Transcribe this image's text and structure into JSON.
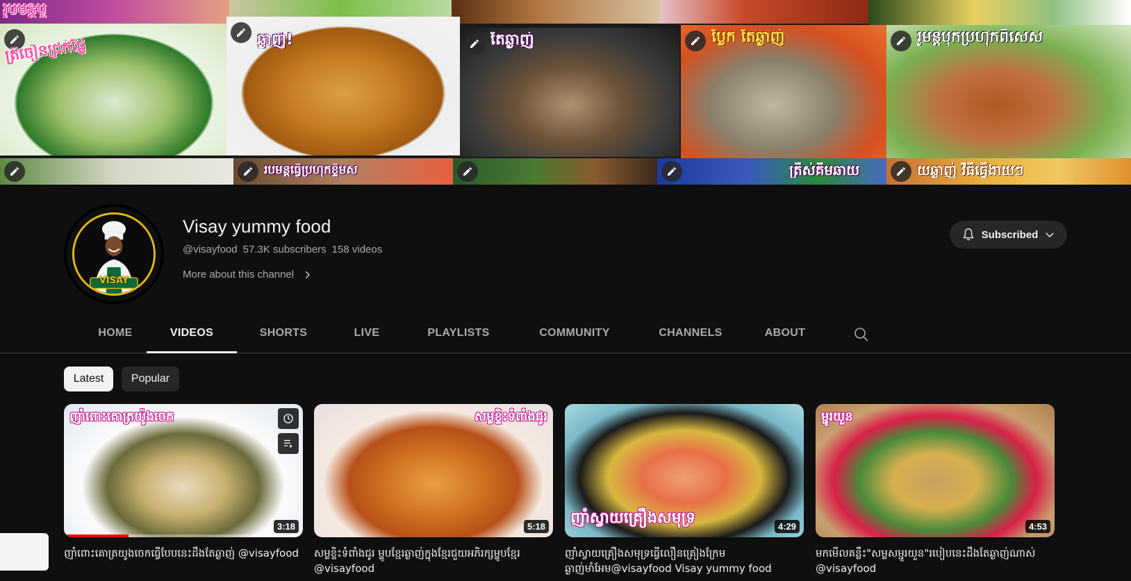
{
  "banner": {
    "tiles": [
      {
        "caption": "រូបមន្តបួ",
        "style": "pink"
      },
      {
        "caption": "",
        "style": ""
      },
      {
        "caption": "",
        "style": ""
      },
      {
        "caption": "",
        "style": ""
      },
      {
        "caption": "",
        "style": ""
      },
      {
        "caption": "ត្រីចៀនជ្រក់ផ្លែ",
        "style": "pink"
      },
      {
        "caption": "ឆ្ងាញ់!",
        "style": ""
      },
      {
        "caption": "តែឆ្ងាញ់",
        "style": ""
      },
      {
        "caption": "ប្លែក តែឆ្ងាញ់",
        "style": ""
      },
      {
        "caption": "រូមន្តបុកប្រហុកពិសេស",
        "style": ""
      },
      {
        "caption": "",
        "style": ""
      },
      {
        "caption": "របមន្តធ្វើប្រហុកខ្ទឹមស",
        "style": "small"
      },
      {
        "caption": "",
        "style": ""
      },
      {
        "caption": "ត្រីស់គីមឆាយ",
        "style": ""
      },
      {
        "caption": "យឆ្ងាញ់ វិធីធ្វើងាយៗ",
        "style": ""
      }
    ]
  },
  "channel": {
    "name": "Visay yummy food",
    "handle": "@visayfood",
    "subscribers": "57.3K subscribers",
    "videos": "158 videos",
    "more_about": "More about this channel",
    "avatar_badge": "VISAY",
    "subscribe_label": "Subscribed"
  },
  "tabs": [
    "HOME",
    "VIDEOS",
    "SHORTS",
    "LIVE",
    "PLAYLISTS",
    "COMMUNITY",
    "CHANNELS",
    "ABOUT"
  ],
  "active_tab": "VIDEOS",
  "chips": [
    "Latest",
    "Popular"
  ],
  "active_chip": "Latest",
  "videos": [
    {
      "thumb_caption": "ញាំពោះគោត្រយ៉ូងចេក",
      "duration": "3:18",
      "watched_fraction": 0.27,
      "title": "ញាំពោះគោត្រយូងចេកធ្វើបែបនេះដឹងតែឆ្ងាញ់ @visayfood"
    },
    {
      "thumb_caption": "សម្លខ្ទិះទំពាំងជូរ",
      "duration": "5:18",
      "watched_fraction": 0,
      "title": "សម្លខ្ទិះទំពាំងជូរ ម្ហូបខ្មែរឆ្ងាញ់ក្នុងខ្មែរជួយអភិរក្សម្ហូបខ្មែរ @visayfood"
    },
    {
      "thumb_caption": "ញាំស្វាយគ្រឿងសមុទ្រ",
      "duration": "4:29",
      "watched_fraction": 0,
      "title": "ញាំស្វាយគ្រឿងសមុទ្រធ្វើលឿនគ្រៀងក្រែមឆ្ងាញ់មាំអែម@visayfood Visay yummy food"
    },
    {
      "thumb_caption": "ម្ជូរយួន",
      "duration": "4:53",
      "watched_fraction": 0,
      "title": "មកមើលគន្លឹះ\"សម្លសម្ជួរយួន\"របៀបនេះដឹងតែឆ្ងាញ់ណាស់ @visayfood"
    }
  ],
  "colors": {
    "background": "#0f0f0f",
    "text_primary": "#f1f1f1",
    "text_secondary": "#aaaaaa",
    "chip_bg": "#272727",
    "progress": "#ff0000",
    "avatar_ring": "#e3b912"
  }
}
